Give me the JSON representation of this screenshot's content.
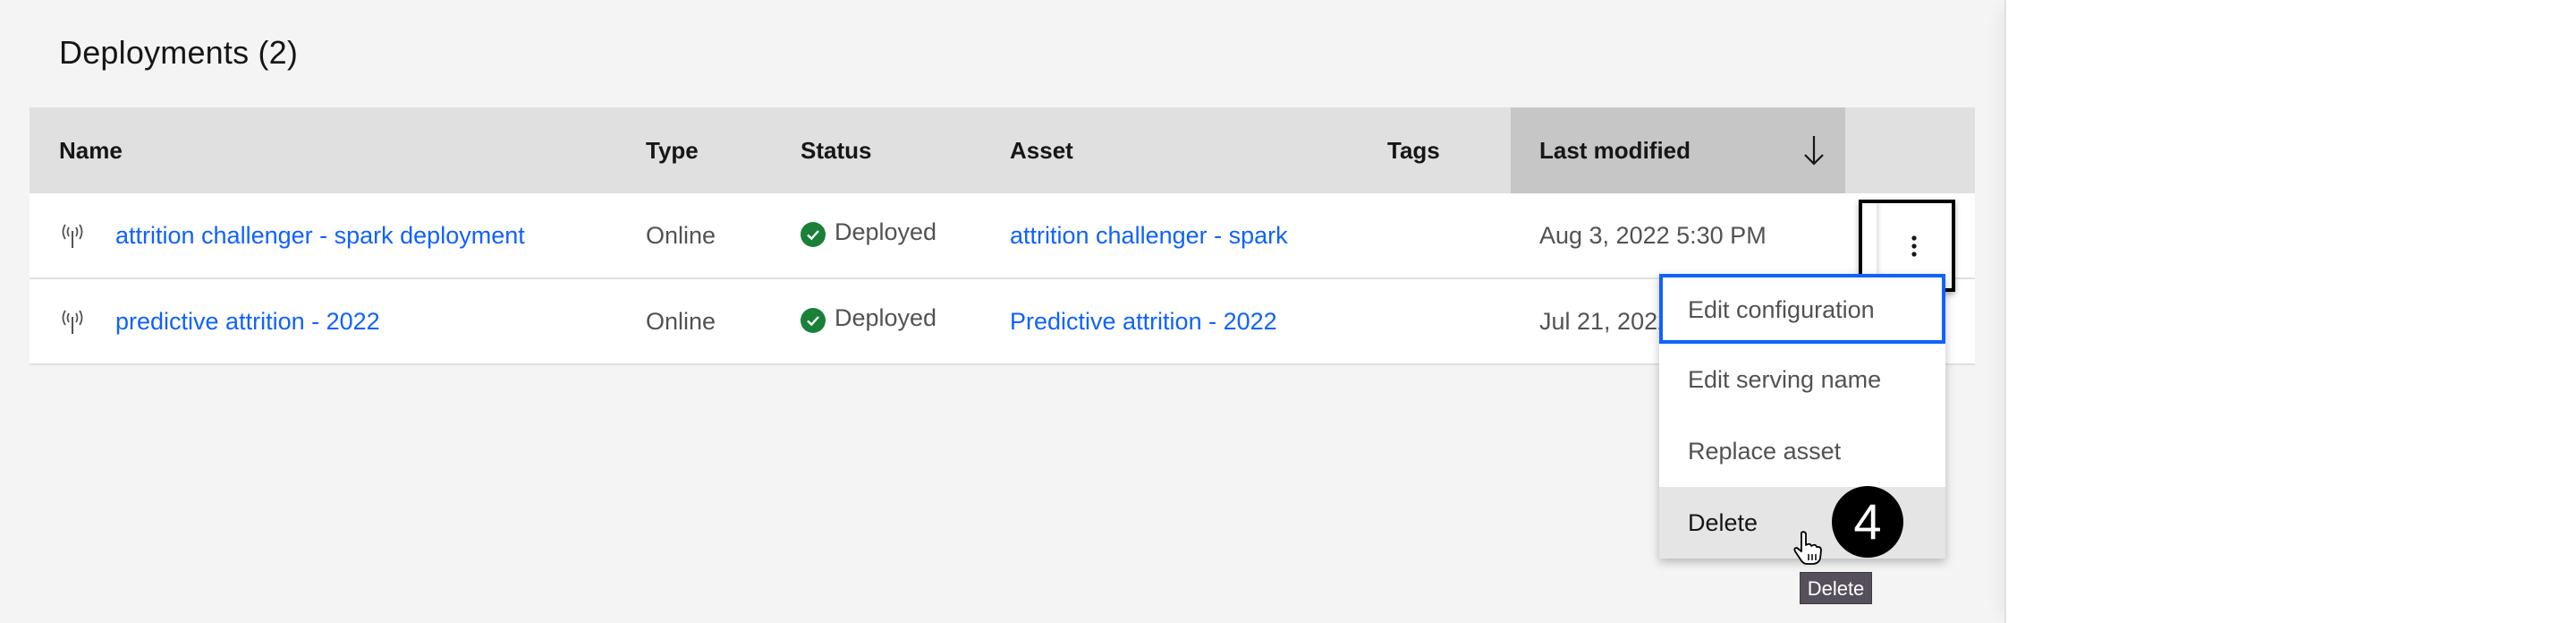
{
  "page": {
    "title": "Deployments (2)"
  },
  "table": {
    "columns": [
      {
        "key": "name",
        "label": "Name"
      },
      {
        "key": "type",
        "label": "Type"
      },
      {
        "key": "status",
        "label": "Status"
      },
      {
        "key": "asset",
        "label": "Asset"
      },
      {
        "key": "tags",
        "label": "Tags"
      },
      {
        "key": "last_modified",
        "label": "Last modified",
        "sort": "descending"
      }
    ],
    "rows": [
      {
        "icon": "online-deployment-antenna-icon",
        "name": "attrition challenger - spark deployment",
        "type": "Online",
        "status": "Deployed",
        "status_icon": "checkmark-filled-icon",
        "asset": "attrition challenger - spark",
        "tags": "",
        "last_modified": "Aug 3, 2022 5:30 PM"
      },
      {
        "icon": "online-deployment-antenna-icon",
        "name": "predictive attrition - 2022",
        "type": "Online",
        "status": "Deployed",
        "status_icon": "checkmark-filled-icon",
        "asset": "Predictive attrition - 2022",
        "tags": "",
        "last_modified": "Jul 21, 2022"
      }
    ]
  },
  "overflow_menu": {
    "trigger_icon": "overflow-menu-vertical-icon",
    "items": [
      {
        "label": "Edit configuration",
        "state": "focused"
      },
      {
        "label": "Edit serving name",
        "state": "default"
      },
      {
        "label": "Replace asset",
        "state": "default"
      },
      {
        "label": "Delete",
        "state": "hovered"
      }
    ]
  },
  "annotation": {
    "step_number": "4"
  },
  "tooltip": {
    "text": "Delete"
  },
  "colors": {
    "link": "#0f62fe",
    "success": "#198038",
    "focus": "#0f62fe",
    "header_bg": "#e0e0e0",
    "sorted_header_bg": "#c6c6c6",
    "page_bg": "#f4f4f4"
  }
}
